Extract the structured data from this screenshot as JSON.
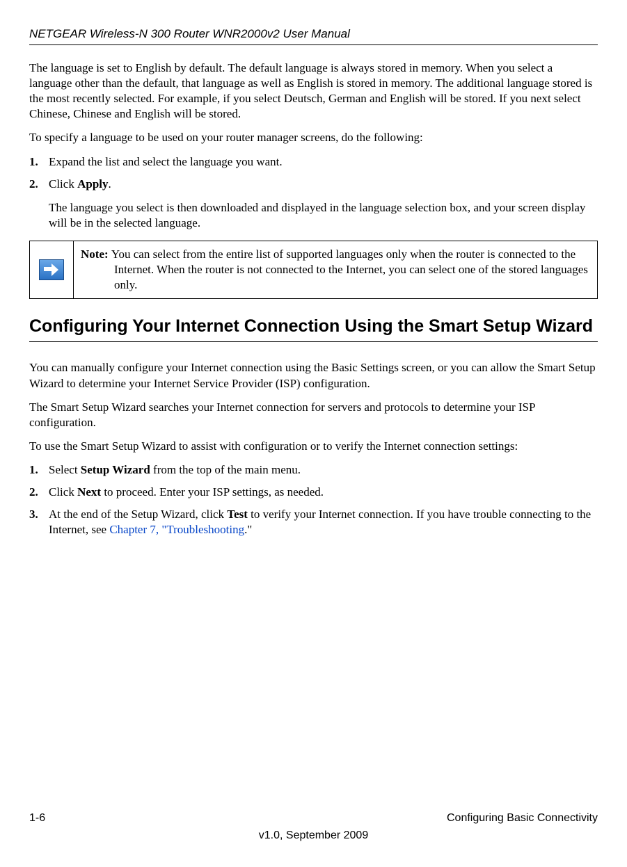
{
  "header": {
    "title": "NETGEAR Wireless-N 300 Router WNR2000v2 User Manual"
  },
  "intro_para": "The language is set to English by default. The default language is always stored in memory. When you select a language other than the default, that language as well as English is stored in memory. The additional language stored is the most recently selected. For example, if you select Deutsch, German and English will be stored. If you next select Chinese, Chinese and English will be stored.",
  "lang_instr": "To specify a language to be used on your router manager screens, do the following:",
  "lang_steps": [
    {
      "num": "1.",
      "text": "Expand the list and select the language you want."
    },
    {
      "num": "2.",
      "pre": "Click ",
      "bold": "Apply",
      "post": "."
    }
  ],
  "lang_result": "The language you select is then downloaded and displayed in the language selection box, and your screen display will be in the selected language.",
  "note": {
    "label": "Note: ",
    "text": "You can select from the entire list of supported languages only when the router is connected to the Internet. When the router is not connected to the Internet, you can select one of the stored languages only."
  },
  "section_heading": "Configuring Your Internet Connection Using the Smart Setup Wizard",
  "wiz_p1": "You can manually configure your Internet connection using the Basic Settings screen, or you can allow the Smart Setup Wizard to determine your Internet Service Provider (ISP) configuration.",
  "wiz_p2": "The Smart Setup Wizard searches your Internet connection for servers and protocols to determine your ISP configuration.",
  "wiz_p3": "To use the Smart Setup Wizard to assist with configuration or to verify the Internet connection settings:",
  "wiz_steps": [
    {
      "num": "1.",
      "pre": "Select ",
      "bold": "Setup Wizard",
      "post": " from the top of the main menu."
    },
    {
      "num": "2.",
      "pre": "Click ",
      "bold": "Next",
      "post": " to proceed. Enter your ISP settings, as needed."
    },
    {
      "num": "3.",
      "pre": "At the end of the Setup Wizard, click ",
      "bold": "Test",
      "post": " to verify your Internet connection. If you have trouble connecting to the Internet, see ",
      "link": "Chapter 7, \"Troubleshooting",
      "tail": ".\""
    }
  ],
  "footer": {
    "page": "1-6",
    "chapter": "Configuring Basic Connectivity",
    "version": "v1.0, September 2009"
  }
}
